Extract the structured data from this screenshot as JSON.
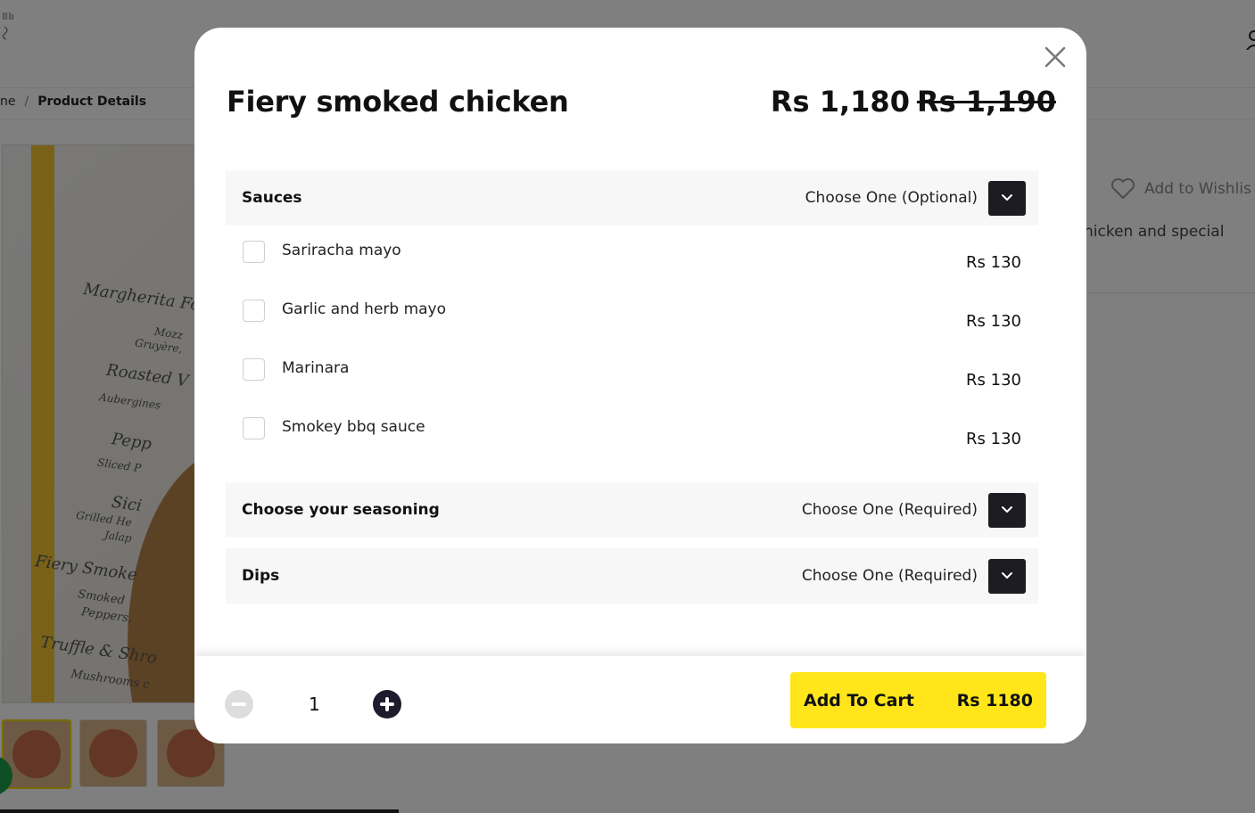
{
  "background": {
    "breadcrumb": {
      "home": "ne",
      "separator": "/",
      "current": "Product Details"
    },
    "wishlist_label": "Add to Wishlis",
    "description_fragment": "nicken and special",
    "image_text": [
      "Margherita Fo",
      "Mozz",
      "Gruyère,",
      "Roasted V",
      "Aubergines",
      "Pepp",
      "Sliced P",
      "Sici",
      "Grilled He",
      "Jalap",
      "Fiery Smoke",
      "Smoked",
      "Peppers,",
      "Truffle & Shro",
      "Mushrooms c"
    ]
  },
  "modal": {
    "title": "Fiery smoked chicken",
    "price_current": "Rs 1,180",
    "price_old": "Rs 1,190",
    "groups": [
      {
        "title": "Sauces",
        "hint": "Choose One (Optional)",
        "options": [
          {
            "label": "Sariracha mayo",
            "price": "Rs 130"
          },
          {
            "label": "Garlic and herb mayo",
            "price": "Rs 130"
          },
          {
            "label": "Marinara",
            "price": "Rs 130"
          },
          {
            "label": "Smokey bbq sauce",
            "price": "Rs 130"
          }
        ]
      },
      {
        "title": "Choose your seasoning",
        "hint": "Choose One (Required)"
      },
      {
        "title": "Dips",
        "hint": "Choose One (Required)"
      }
    ],
    "footer": {
      "quantity": "1",
      "add_to_cart_label": "Add To Cart",
      "add_to_cart_price": "Rs 1180"
    }
  },
  "colors": {
    "accent": "#ffe51a",
    "dark_button": "#1c1c22",
    "group_background": "#f7f7f7"
  },
  "icons": {
    "close": "close-icon",
    "chevron": "chevron-down-icon",
    "minus": "minus-circle-icon",
    "plus": "plus-circle-icon",
    "heart": "heart-icon"
  }
}
